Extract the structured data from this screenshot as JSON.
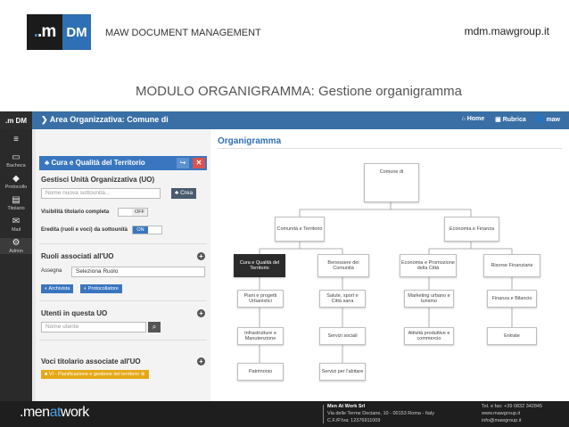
{
  "header": {
    "logo_m": ".m",
    "logo_dm": "DM",
    "brand": "MAW DOCUMENT MANAGEMENT",
    "site": "mdm.mawgroup.it",
    "subtitle": "MODULO ORGANIGRAMMA: Gestione organigramma"
  },
  "topbar": {
    "mini_logo": ".m DM",
    "area_title": "Area Organizzativa: Comune di",
    "nav": [
      "Home",
      "Rubrica",
      "maw"
    ]
  },
  "sidebar": {
    "items": [
      "Bacheca",
      "Protocollo",
      "Titolario",
      "Mail",
      "Admin"
    ]
  },
  "panel": {
    "title": "Cura e Qualità del Territorio",
    "share_icon": "share-icon",
    "gestisci": "Gestisci Unità Organizzativa (UO)",
    "new_sub_placeholder": "Nome nuova sottounità...",
    "crea": "Crea",
    "visibilita_label": "Visibilità titolario completa",
    "visibilita_value": "OFF",
    "eredita_label": "Eredita (ruoli e voci) da sottounità",
    "eredita_value": "ON",
    "ruoli": "Ruoli associati all'UO",
    "assegna": "Assegna",
    "ruolo_select": "Seleziona Ruolo",
    "archivista": "Archivista",
    "protocollatore": "Protocollatore",
    "utenti": "Utenti in questa UO",
    "utente_placeholder": "Nome utente",
    "voci": "Voci titolario associate all'UO",
    "voce_tag": "VI - Pianificazione e gestione del territorio"
  },
  "chart": {
    "title": "Organigramma",
    "root": "Comune di",
    "level1": [
      "Comunità e Territorio",
      "Economia e Finanza"
    ],
    "level2": [
      "Cura e Qualità del Territorio",
      "Benessere dei Comunità",
      "Economia e Promozione della Città",
      "Risorse Finanziarie"
    ],
    "col1": [
      "Piani e progetti Urbanistici",
      "Infrastrutture e Manutenzione",
      "Patrimonio"
    ],
    "col2": [
      "Salute, sport e Città sana",
      "Servizi sociali",
      "Servizi per l'abitare"
    ],
    "col3": [
      "Marketing urbano e turismo",
      "Attività produttive e commercio"
    ],
    "col4": [
      "Finanza e Bilancio",
      "Entrate"
    ]
  },
  "footer": {
    "brand_a": ".men",
    "brand_b": "at",
    "brand_c": "work",
    "company": "Men At Work Srl",
    "address": "Via delle Terme Deciane, 10 - 00153 Roma - Italy",
    "vat": "C.F./P.Iva: 12376911009",
    "phone": "Tel. e fax: +39 0832 342845",
    "web": "www.mawgroup.it",
    "email": "info@mawgroup.it"
  }
}
